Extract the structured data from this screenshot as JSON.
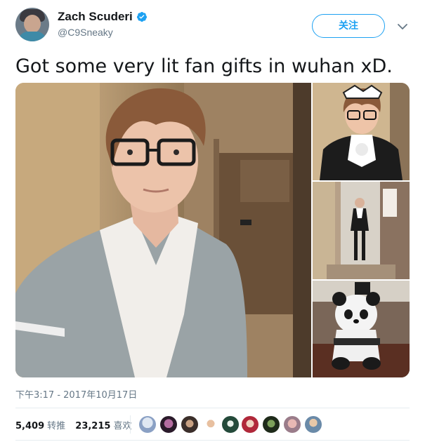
{
  "author": {
    "name": "Zach Scuderi",
    "handle": "@C9Sneaky"
  },
  "follow_button": "关注",
  "tweet": {
    "text": "Got some very lit fan gifts in wuhan xD."
  },
  "meta": {
    "timestamp": "下午3:17 - 2017年10月17日"
  },
  "stats": {
    "retweets_count": "5,409",
    "retweets_label": "转推",
    "likes_count": "23,215",
    "likes_label": "喜欢"
  },
  "icons": {
    "verified": "verified-badge-icon",
    "menu": "chevron-down-icon"
  },
  "colors": {
    "accent": "#1da1f2",
    "text_primary": "#14171a",
    "text_secondary": "#657786",
    "divider": "#e6ecf0"
  }
}
